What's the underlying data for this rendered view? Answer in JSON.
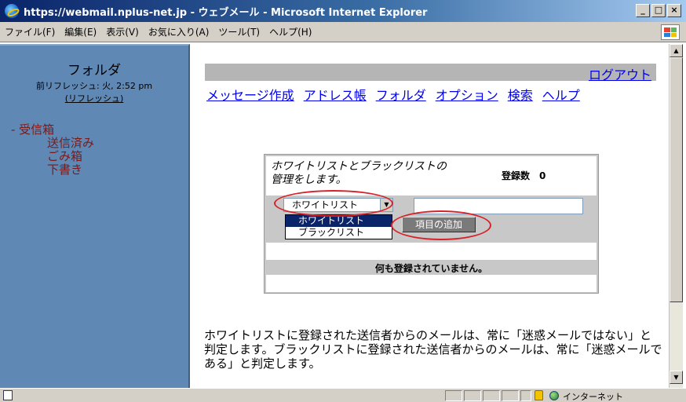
{
  "window": {
    "title": "https://webmail.nplus-net.jp - ウェブメール - Microsoft Internet Explorer",
    "min": "_",
    "max": "□",
    "close": "×"
  },
  "menubar": {
    "items": [
      "ファイル(F)",
      "編集(E)",
      "表示(V)",
      "お気に入り(A)",
      "ツール(T)",
      "ヘルプ(H)"
    ]
  },
  "sidebar": {
    "title": "フォルダ",
    "refresh_info": "前リフレッシュ: 火, 2:52 pm",
    "refresh_link": "(リフレッシュ)",
    "folders": [
      {
        "label": "- 受信箱"
      },
      {
        "label": "送信済み"
      },
      {
        "label": "ごみ箱"
      },
      {
        "label": "下書き"
      }
    ]
  },
  "main": {
    "logout": "ログアウト",
    "nav": [
      "メッセージ作成",
      "アドレス帳",
      "フォルダ",
      "オプション",
      "検索",
      "ヘルプ"
    ],
    "panel": {
      "desc_line1": "ホワイトリストとブラックリストの",
      "desc_line2": "管理をします。",
      "count_label": "登録数　0",
      "select_value": "ホワイトリスト",
      "options": [
        "ホワイトリスト",
        "ブラックリスト"
      ],
      "add_button": "項目の追加",
      "empty_message": "何も登録されていません。"
    },
    "footer_text": "ホワイトリストに登録された送信者からのメールは、常に「迷惑メールではない」と判定します。ブラックリストに登録された送信者からのメールは、常に「迷惑メールである」と判定します。"
  },
  "statusbar": {
    "zone": "インターネット"
  },
  "colors": {
    "sidebar_bg": "#5f88b4",
    "link": "#0000ee",
    "folder_text": "#7a1a1a",
    "highlight_ellipse": "#d8222a"
  }
}
